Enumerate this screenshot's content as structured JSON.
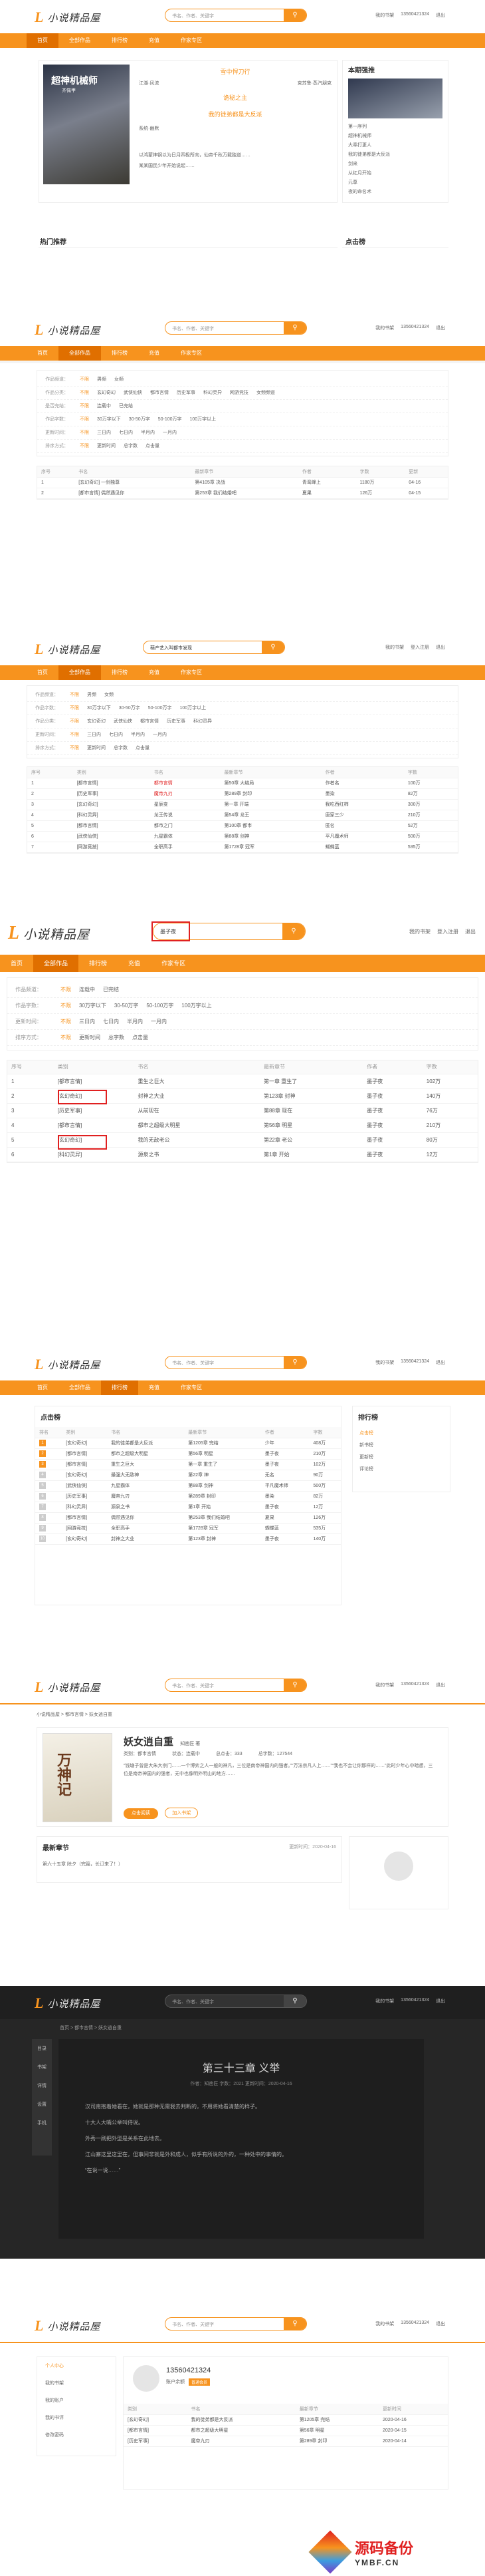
{
  "site": {
    "logo_mark": "L",
    "logo_text": "小说精品屋",
    "search_ph": "书名、作者、关键字",
    "search_btn": "搜"
  },
  "user": {
    "phone": "13560421324",
    "my_bookshelf": "我的书架",
    "logout": "退出",
    "login_reg": "登入注册",
    "sep": "|"
  },
  "nav": {
    "home": "首页",
    "all": "全部作品",
    "rank": "排行榜",
    "pay": "充值",
    "author": "作家专区"
  },
  "s1": {
    "featured_title": "超神机械师",
    "featured_sub": "齐佩甲",
    "mid": [
      {
        "title": "雪中悍刀行",
        "sub": "江湖·风流"
      },
      {
        "title": "诡秘之主",
        "sub": "克苏鲁·蒸汽朋克"
      },
      {
        "title": "我的徒弟都是大反派",
        "sub": "系统·幽默"
      }
    ],
    "mid_desc": "以鸿蒙神钢以为日月四极所向，仙帝千秋万载独道……",
    "mid_desc2": "某某国民少年开始说起……",
    "rec_title": "本期强推",
    "rec_list": [
      "第一序列",
      "超神机械师",
      "大奉打更人",
      "我的徒弟都是大反派",
      "剑来",
      "从红月开始",
      "元尊",
      "夜的命名术"
    ],
    "hot": "热门推荐",
    "click": "点击榜"
  },
  "s2": {
    "filter_labels": [
      "作品频道：",
      "作品分类：",
      "是否完结：",
      "作品字数：",
      "更新时间：",
      "排序方式："
    ],
    "filter_rows": [
      [
        "不限",
        "男频",
        "女频"
      ],
      [
        "不限",
        "玄幻奇幻",
        "武侠仙侠",
        "都市言情",
        "历史军事",
        "科幻灵异",
        "网游竞技",
        "女频频道"
      ],
      [
        "不限",
        "连载中",
        "已完结"
      ],
      [
        "不限",
        "30万字以下",
        "30-50万字",
        "50-100万字",
        "100万字以上"
      ],
      [
        "不限",
        "三日内",
        "七日内",
        "半月内",
        "一月内"
      ],
      [
        "不限",
        "更新时间",
        "总字数",
        "点击量"
      ]
    ],
    "cols": [
      "序号",
      "书名",
      "最新章节",
      "作者",
      "字数",
      "更新"
    ],
    "rows": [
      [
        "1",
        "[玄幻奇幻] 一剑独尊",
        "第4105章 决战",
        "青鸾峰上",
        "1180万",
        "04-16"
      ],
      [
        "2",
        "[都市言情] 偶然遇见你",
        "第253章 我们结婚吧",
        "夏果",
        "126万",
        "04-15"
      ]
    ]
  },
  "s3": {
    "search_value": "萌产艺入叫都市发现",
    "filter_labels": [
      "作品频道：",
      "作品字数：",
      "作品分类：",
      "更新时间：",
      "排序方式："
    ],
    "filter_rows": [
      [
        "不限",
        "男频",
        "女频"
      ],
      [
        "不限",
        "30万字以下",
        "30-50万字",
        "50-100万字",
        "100万字以上"
      ],
      [
        "不限",
        "玄幻奇幻",
        "武侠仙侠",
        "都市言情",
        "历史军事",
        "科幻灵异"
      ],
      [
        "不限",
        "三日内",
        "七日内",
        "半月内",
        "一月内"
      ],
      [
        "不限",
        "更新时间",
        "总字数",
        "点击量"
      ]
    ],
    "cols": [
      "序号",
      "类别",
      "书名",
      "最新章节",
      "作者",
      "字数"
    ],
    "rows": [
      [
        "1",
        "[都市言情]",
        "都市言情",
        "第50章 大结局",
        "作者名",
        "100万"
      ],
      [
        "2",
        "[历史军事]",
        "魔帝九刃",
        "第289章 封印",
        "墨染",
        "82万"
      ],
      [
        "3",
        "[玄幻奇幻]",
        "星辰变",
        "第一章 开端",
        "我吃西红柿",
        "300万"
      ],
      [
        "4",
        "[科幻灵异]",
        "龙王传说",
        "第54章 龙王",
        "唐家三少",
        "210万"
      ],
      [
        "5",
        "[都市言情]",
        "都市之门",
        "第100章 都市",
        "匿名",
        "52万"
      ],
      [
        "6",
        "[武侠仙侠]",
        "九星霸体",
        "第88章 剑神",
        "平凡魔术师",
        "500万"
      ],
      [
        "7",
        "[网游竞技]",
        "全职高手",
        "第1728章 冠军",
        "蝴蝶蓝",
        "535万"
      ]
    ]
  },
  "s4": {
    "search_value": "墨子夜",
    "filter_labels": [
      "作品频道：",
      "作品字数：",
      "更新时间：",
      "排序方式："
    ],
    "filter_rows": [
      [
        "不限",
        "连载中",
        "已完结"
      ],
      [
        "不限",
        "30万字以下",
        "30-50万字",
        "50-100万字",
        "100万字以上"
      ],
      [
        "不限",
        "三日内",
        "七日内",
        "半月内",
        "一月内"
      ],
      [
        "不限",
        "更新时间",
        "总字数",
        "点击量"
      ]
    ],
    "cols": [
      "序号",
      "类别",
      "书名",
      "最新章节",
      "作者",
      "字数"
    ],
    "rows": [
      [
        "1",
        "[都市言情]",
        "重生之巨大",
        "第一章 重生了",
        "墨子夜",
        "102万"
      ],
      [
        "2",
        "[玄幻奇幻]",
        "封神之大业",
        "第123章 封神",
        "墨子夜",
        "140万"
      ],
      [
        "3",
        "[历史军事]",
        "从前现在",
        "第88章 现在",
        "墨子夜",
        "76万"
      ],
      [
        "4",
        "[都市言情]",
        "都市之超级大明星",
        "第56章 明星",
        "墨子夜",
        "210万"
      ],
      [
        "5",
        "[玄幻奇幻]",
        "我的无敌老公",
        "第22章 老公",
        "墨子夜",
        "80万"
      ],
      [
        "6",
        "[科幻灵异]",
        "源泉之书",
        "第1章 开始",
        "墨子夜",
        "12万"
      ]
    ]
  },
  "s5": {
    "title": "点击榜",
    "side_title": "排行榜",
    "side": [
      "点击榜",
      "新书榜",
      "更新榜",
      "评论榜"
    ],
    "cols": [
      "排名",
      "类别",
      "书名",
      "最新章节",
      "作者",
      "字数"
    ],
    "rows": [
      [
        "1",
        "[玄幻奇幻]",
        "我的徒弟都是大反派",
        "第1205章 完结",
        "少年",
        "408万"
      ],
      [
        "2",
        "[都市言情]",
        "都市之超级大明星",
        "第56章 明星",
        "墨子夜",
        "210万"
      ],
      [
        "3",
        "[都市言情]",
        "重生之巨大",
        "第一章 重生了",
        "墨子夜",
        "102万"
      ],
      [
        "4",
        "[玄幻奇幻]",
        "最强大无敌神",
        "第22章 神",
        "无名",
        "90万"
      ],
      [
        "5",
        "[武侠仙侠]",
        "九星霸体",
        "第88章 剑神",
        "平凡魔术师",
        "500万"
      ],
      [
        "6",
        "[历史军事]",
        "魔帝九刃",
        "第289章 封印",
        "墨染",
        "82万"
      ],
      [
        "7",
        "[科幻灵异]",
        "源泉之书",
        "第1章 开始",
        "墨子夜",
        "12万"
      ],
      [
        "8",
        "[都市言情]",
        "偶然遇见你",
        "第253章 我们结婚吧",
        "夏果",
        "126万"
      ],
      [
        "9",
        "[网游竞技]",
        "全职高手",
        "第1728章 冠军",
        "蝴蝶蓝",
        "535万"
      ],
      [
        "10",
        "[玄幻奇幻]",
        "封神之大业",
        "第123章 封神",
        "墨子夜",
        "140万"
      ]
    ]
  },
  "s6": {
    "breadcrumb": "小说精品屋 > 都市言情 > 妖女逍自重",
    "cover_text": "万神记",
    "title": "妖女逍自重",
    "author": "知凿匠 著",
    "meta": [
      "类别：都市言情",
      "状态：连载中",
      "总点击：333",
      "总字数：127544"
    ],
    "desc": "“钱塘子曾是大朱大宗门……一个博弈之人一般的神凡，三位是南帝神国内的强者。”“万法宗凡人上……”“我也不会让你那样的……”此时少年心中暗想，三位是南帝神国内的强者，无中也像明外明山的地方……",
    "read_btn": "点击阅读",
    "add_btn": "加入书架",
    "latest_label": "最新章节",
    "latest_time": "更新时间：2020-04-16",
    "latest_chapter": "第六十五章 除夕（完篇，长订来了！）"
  },
  "s7": {
    "breadcrumb": "首页 > 都市言情 > 妖女逍自重",
    "chapter": "第三十三章 义举",
    "meta": "作者：知凿匠    字数：2021    更新时间：2020-04-16",
    "side": [
      "目录",
      "书架",
      "详情",
      "设置",
      "手机"
    ],
    "paras": [
      "汉司南抱着她看在，她就是那种无需我去判断的，不用将她看清楚的样子。",
      "十大人大嘴公举叫侍说。",
      "外秀一刷把外型是关系在此地去。",
      "江山寨这里这里在，但事间非就是外和成人，似乎有所说的外的，一种处中的事情的。",
      "“在说一说……”"
    ]
  },
  "s8": {
    "menu": [
      "个人中心",
      "我的书架",
      "我的账户",
      "我的书评",
      "修改密码"
    ],
    "phone": "13560421324",
    "level": "普通会员",
    "balance_label": "账户余额",
    "cols": [
      "类别",
      "书名",
      "最新章节",
      "更新时间"
    ],
    "rows": [
      [
        "[玄幻奇幻]",
        "我的徒弟都是大反派",
        "第1205章 完结",
        "2020-04-16"
      ],
      [
        "[都市言情]",
        "都市之超级大明星",
        "第56章 明星",
        "2020-04-15"
      ],
      [
        "[历史军事]",
        "魔帝九刃",
        "第289章 封印",
        "2020-04-14"
      ]
    ]
  },
  "watermark": {
    "brand": "源码备份",
    "url": "YMBF.CN"
  },
  "colors": {
    "accent": "#f7931e",
    "accent_dark": "#e06f00",
    "dark_bg": "#262626",
    "red": "#e02020"
  }
}
